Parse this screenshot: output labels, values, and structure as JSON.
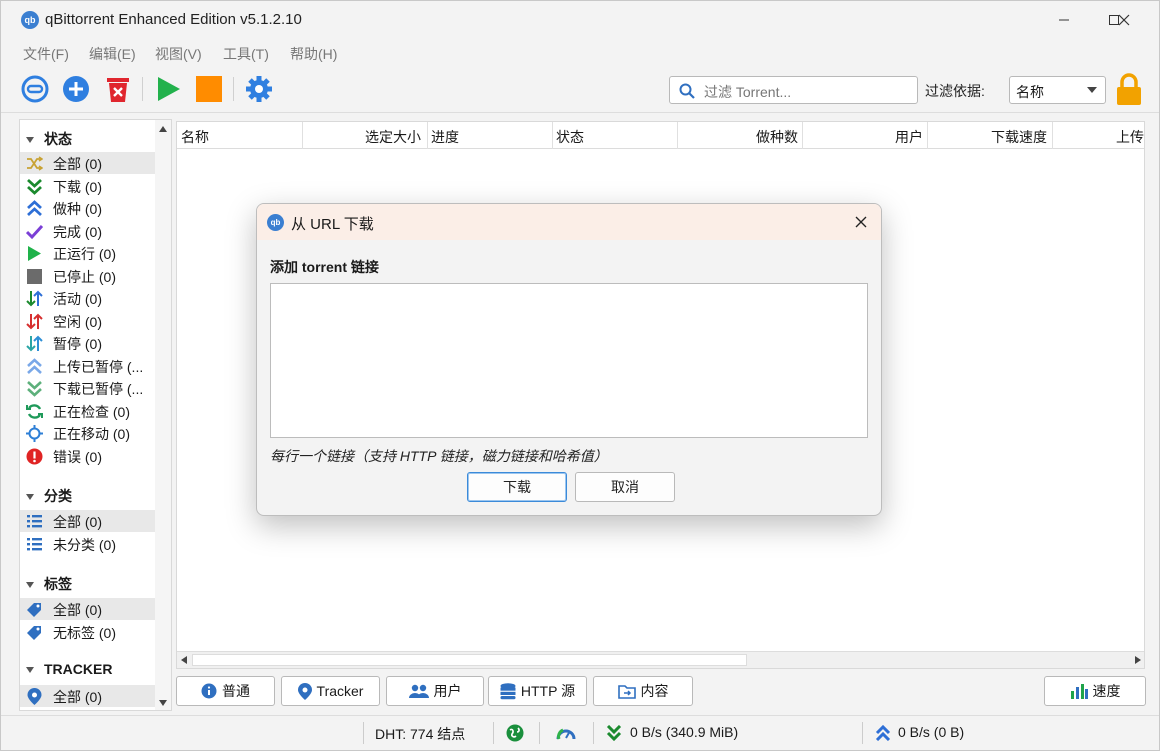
{
  "window": {
    "title": "qBittorrent Enhanced Edition v5.1.2.10"
  },
  "menu": [
    "文件(F)",
    "编辑(E)",
    "视图(V)",
    "工具(T)",
    "帮助(H)"
  ],
  "toolbar": {
    "filter_placeholder": "过滤 Torrent...",
    "filter_by_label": "过滤依据:",
    "filter_by_value": "名称"
  },
  "sidebar": {
    "status_header": "状态",
    "status_items": [
      {
        "label": "全部 (0)",
        "icon": "shuffle-icon",
        "color": "#c8a234"
      },
      {
        "label": "下载 (0)",
        "icon": "download-icon",
        "color": "#1b8a2e"
      },
      {
        "label": "做种 (0)",
        "icon": "seeding-icon",
        "color": "#2e6fd6"
      },
      {
        "label": "完成 (0)",
        "icon": "check-icon",
        "color": "#7b3fd6"
      },
      {
        "label": "正运行 (0)",
        "icon": "play-icon",
        "color": "#1fb24a"
      },
      {
        "label": "已停止 (0)",
        "icon": "stop-icon",
        "color": "#6b6b6b"
      },
      {
        "label": "活动 (0)",
        "icon": "active-arrows-icon",
        "color": "#1b8a2e"
      },
      {
        "label": "空闲 (0)",
        "icon": "inactive-arrows-icon",
        "color": "#d62f2f"
      },
      {
        "label": "暂停 (0)",
        "icon": "paused-arrows-icon",
        "color": "#2aa5a5"
      },
      {
        "label": "上传已暂停 (...",
        "icon": "upload-paused-icon",
        "color": "#7aa8e8"
      },
      {
        "label": "下载已暂停 (...",
        "icon": "download-paused-icon",
        "color": "#5db07b"
      },
      {
        "label": "正在检查 (0)",
        "icon": "checking-icon",
        "color": "#1f9a5a"
      },
      {
        "label": "正在移动 (0)",
        "icon": "moving-icon",
        "color": "#2e7fd6"
      },
      {
        "label": "错误 (0)",
        "icon": "error-icon",
        "color": "#e02424"
      }
    ],
    "category_header": "分类",
    "category_items": [
      {
        "label": "全部 (0)",
        "icon": "list-icon"
      },
      {
        "label": "未分类 (0)",
        "icon": "list-icon"
      }
    ],
    "tag_header": "标签",
    "tag_items": [
      {
        "label": "全部 (0)",
        "icon": "tag-icon"
      },
      {
        "label": "无标签 (0)",
        "icon": "tag-icon"
      }
    ],
    "tracker_header": "TRACKER",
    "tracker_items": [
      {
        "label": "全部 (0)",
        "icon": "location-pin-icon"
      }
    ]
  },
  "columns": [
    "名称",
    "选定大小",
    "进度",
    "状态",
    "做种数",
    "用户",
    "下载速度",
    "上传"
  ],
  "tabs": [
    "普通",
    "Tracker",
    "用户",
    "HTTP 源",
    "内容"
  ],
  "speed_button": "速度",
  "status": {
    "dht": "DHT: 774 结点",
    "download": "0 B/s (340.9 MiB)",
    "upload": "0 B/s (0 B)"
  },
  "dialog": {
    "title": "从 URL 下载",
    "label": "添加 torrent 链接",
    "hint": "每行一个链接（支持 HTTP 链接，磁力链接和哈希值）",
    "ok": "下载",
    "cancel": "取消"
  }
}
